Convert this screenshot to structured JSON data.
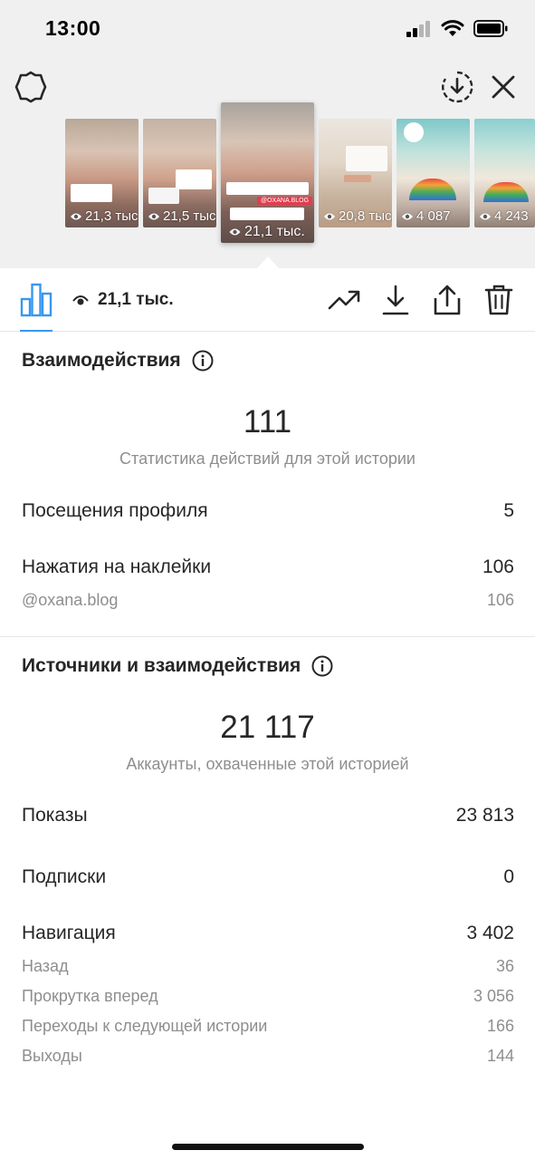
{
  "status_bar": {
    "time": "13:00",
    "icons": [
      "signal-icon",
      "wifi-icon",
      "battery-icon"
    ]
  },
  "header": {
    "icons": [
      "settings-icon",
      "save-download-icon",
      "close-icon"
    ]
  },
  "stories": [
    {
      "views": "21,3 тыс.",
      "active": false
    },
    {
      "views": "21,5 тыс.",
      "active": false
    },
    {
      "views": "21,1 тыс.",
      "active": true,
      "tag": "@OXANA.BLOG"
    },
    {
      "views": "20,8 тыс.",
      "active": false
    },
    {
      "views": "4 087",
      "active": false
    },
    {
      "views": "4 243",
      "active": false
    }
  ],
  "toolbar": {
    "views": "21,1 тыс.",
    "icons": [
      "insights-bar-chart-icon",
      "eye-icon",
      "promote-trend-icon",
      "download-icon",
      "share-icon",
      "trash-icon"
    ],
    "accent_color": "#3897f0"
  },
  "interactions": {
    "title": "Взаимодействия",
    "total": "111",
    "caption": "Статистика действий для этой истории",
    "rows": [
      {
        "label": "Посещения профиля",
        "value": "5"
      },
      {
        "label": "Нажатия на наклейки",
        "value": "106"
      }
    ],
    "sub_rows": [
      {
        "label": "@oxana.blog",
        "value": "106"
      }
    ]
  },
  "discovery": {
    "title": "Источники и взаимодействия",
    "total": "21 117",
    "caption": "Аккаунты, охваченные этой историей",
    "rows": [
      {
        "label": "Показы",
        "value": "23 813"
      },
      {
        "label": "Подписки",
        "value": "0"
      },
      {
        "label": "Навигация",
        "value": "3 402"
      }
    ],
    "navigation_rows": [
      {
        "label": "Назад",
        "value": "36"
      },
      {
        "label": "Прокрутка вперед",
        "value": "3 056"
      },
      {
        "label": "Переходы к следующей истории",
        "value": "166"
      },
      {
        "label": "Выходы",
        "value": "144"
      }
    ]
  }
}
